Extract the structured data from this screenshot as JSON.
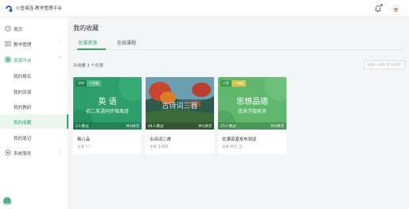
{
  "topbar": {
    "brand": "小鱼易连·教学管理平台",
    "logo_icon": "logo-icon",
    "bell_icon": "bell-icon",
    "avatar_icon": "avatar-icon"
  },
  "sidebar": {
    "items": [
      {
        "label": "首页",
        "icon": "home-icon"
      },
      {
        "label": "教学管理",
        "icon": "book-icon"
      },
      {
        "label": "资源平台",
        "icon": "resource-icon"
      },
      {
        "label": "系统服务",
        "icon": "settings-icon"
      }
    ],
    "sub_items": [
      {
        "label": "我的报名"
      },
      {
        "label": "我的资源"
      },
      {
        "label": "我的教研"
      },
      {
        "label": "我的收藏"
      },
      {
        "label": "我的笔记"
      }
    ],
    "active_sub": "我的收藏"
  },
  "main": {
    "title": "我的收藏",
    "tabs": [
      {
        "label": "优课资源",
        "active": true
      },
      {
        "label": "在线课程",
        "active": false
      }
    ],
    "count_text": "共收藏 3 个优课",
    "search_placeholder": "请输入课程/老师名称"
  },
  "cards": [
    {
      "tags": [
        "初中",
        "二年级"
      ],
      "cover_title": "英  语",
      "cover_sub": "初二英语同步微离班",
      "learners": "2人看过",
      "lessons": "共3讲次",
      "name": "枫儿朵",
      "author": "主讲 ???"
    },
    {
      "tags": [],
      "cover_title": "古诗词三首",
      "cover_sub": "",
      "learners": "44人看过",
      "lessons": "共1讲次",
      "name": "古诗词三首",
      "author": "主讲 王明辉"
    },
    {
      "tags": [
        "小学",
        "一年级"
      ],
      "cover_title": "思想品德",
      "cover_sub": "我来学做家务",
      "learners": "25人看过",
      "lessons": "共3讲次",
      "name": "优课资源发布测试",
      "author": "主讲 周芳_五..."
    }
  ],
  "colors": {
    "accent": "#2fa86b",
    "card1_bg": "#2e9e6a",
    "card3_bg": "#5fb86d"
  }
}
